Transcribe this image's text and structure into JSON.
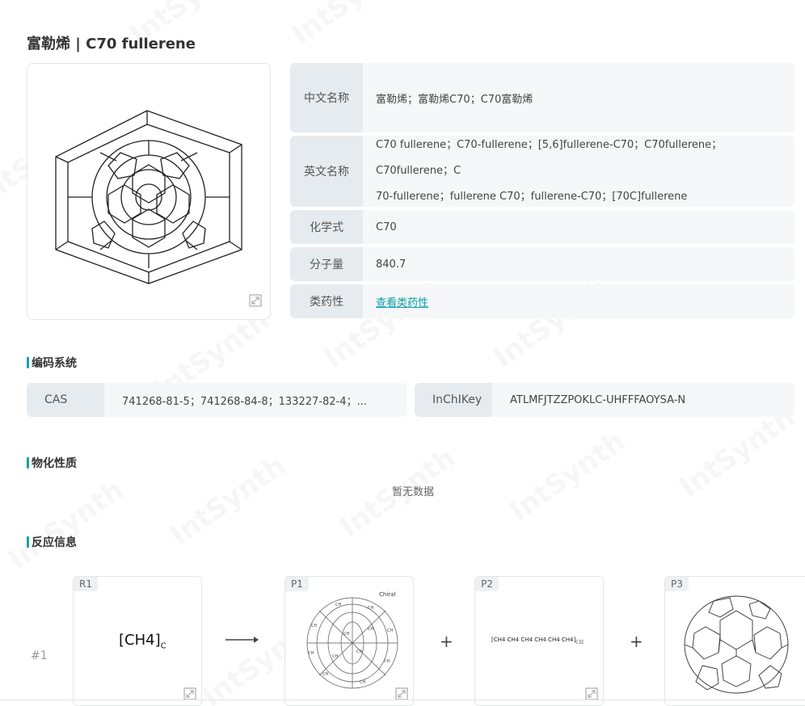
{
  "page": {
    "title": "富勒烯 | C70 fullerene"
  },
  "info": {
    "rows": [
      {
        "label": "中文名称",
        "value": "富勒烯；富勒烯C70；C70富勒烯"
      },
      {
        "label": "英文名称",
        "value_line1": "C70 fullerene；C70-fullerene；[5,6]fullerene-C70；C70fullerene；C70fullerene；C",
        "value_line2": "70-fullerene；fullerene C70；fullerene-C70；[70C]fullerene"
      },
      {
        "label": "化学式",
        "value": "C70"
      },
      {
        "label": "分子量",
        "value": "840.7"
      },
      {
        "label": "类药性",
        "value": "查看类药性"
      }
    ]
  },
  "sections": {
    "coding": "编码系统",
    "physchem": "物化性质",
    "reaction": "反应信息"
  },
  "codes": {
    "cas_label": "CAS",
    "cas_value": "741268-81-5；741268-84-8；133227-82-4；...",
    "inchikey_label": "InChIKey",
    "inchikey_value": "ATLMFJTZZPOKLC-UHFFFAOYSA-N"
  },
  "physchem": {
    "empty_text": "暂无数据"
  },
  "reaction": {
    "index": "#1",
    "r1": {
      "badge": "R1",
      "formula": "[CH4]",
      "subscript": "C"
    },
    "p1": {
      "badge": "P1",
      "chiral": "Chiral"
    },
    "p2": {
      "badge": "P2",
      "formula": "[CH4  CH4  CH4  CH4  CH4  CH4]",
      "subscript": "C32"
    },
    "p3": {
      "badge": "P3"
    },
    "plus": "+"
  },
  "watermark": "IntSynth",
  "colors": {
    "accent": "#17a2a6",
    "link": "#0a9fa8",
    "label_bg": "#e6ebef",
    "value_bg": "#f5f7f9"
  }
}
